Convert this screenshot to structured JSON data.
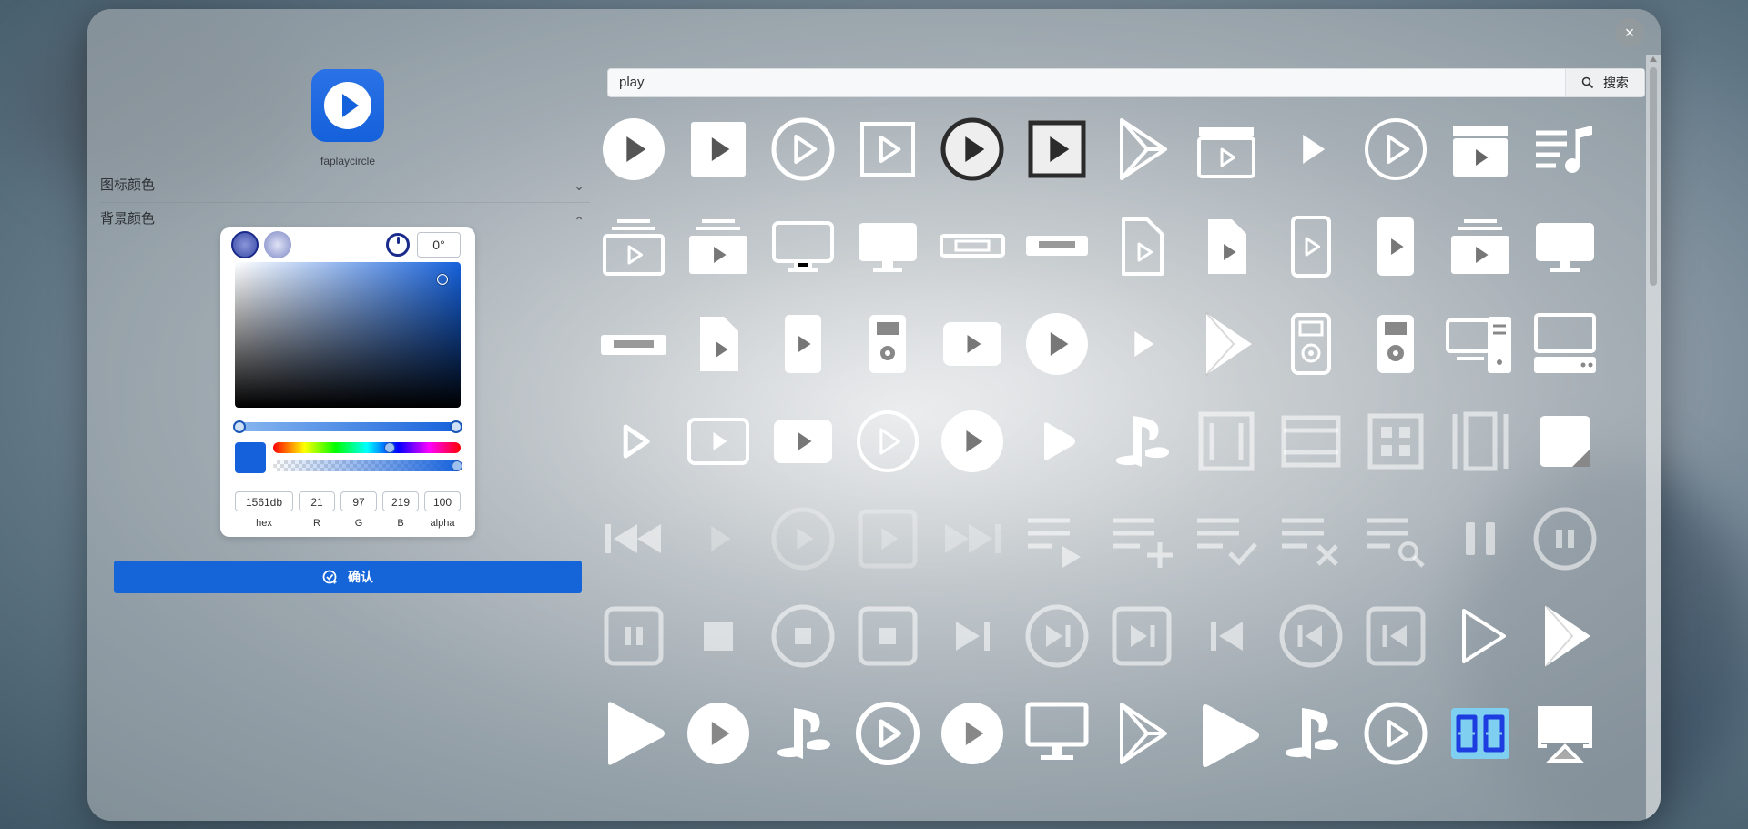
{
  "dialog": {
    "close_label": "×"
  },
  "preview": {
    "icon_name": "faplaycircle",
    "label": "faplaycircle"
  },
  "sections": {
    "icon_color": "图标颜色",
    "bg_color": "背景颜色"
  },
  "picker": {
    "angle": "0°",
    "hex": "1561db",
    "r": "21",
    "g": "97",
    "b": "219",
    "alpha": "100",
    "labels": {
      "hex": "hex",
      "r": "R",
      "g": "G",
      "b": "B",
      "alpha": "alpha"
    },
    "color": "#1561db"
  },
  "confirm_label": "确认",
  "search": {
    "value": "play",
    "button_label": "搜索"
  },
  "icons": [
    [
      "play-circle-filled",
      "play-square-filled",
      "play-circle-outline",
      "play-square-outline",
      "play-circle-dark",
      "play-square-dark",
      "google-play-outline",
      "clapperboard-play",
      "play-triangle",
      "play-circle-thin",
      "clapperboard-filled",
      "playlist-music"
    ],
    [
      "subscriptions-outline",
      "subscriptions-filled",
      "monitor-outline",
      "monitor-filled",
      "vhs-outline",
      "vhs-filled",
      "file-play-outline",
      "file-play-filled",
      "phone-play-outline",
      "phone-play-filled",
      "subscriptions-filled-alt",
      "monitor-filled-alt"
    ],
    [
      "vhs-filled-alt",
      "file-play-filled-alt",
      "phone-play-filled-alt",
      "ipod-filled",
      "video-play-filled",
      "play-circle-solid",
      "play-triangle-small",
      "google-play-filled",
      "ipod-outline",
      "ipod-solid",
      "devices-outline",
      "desktop-tower"
    ],
    [
      "play-outline-triangle",
      "video-play-outline",
      "video-play-solid",
      "play-circle-ring",
      "play-circle-solid-alt",
      "play-triangle-rounded",
      "playstation",
      "view-carousel",
      "view-agenda",
      "view-module",
      "view-array",
      "note-filled"
    ],
    [
      "skip-back",
      "play-faint",
      "play-circle-faint",
      "play-square-faint",
      "skip-forward",
      "playlist-play",
      "playlist-add",
      "playlist-check",
      "playlist-remove",
      "playlist-search",
      "pause",
      "pause-circle"
    ],
    [
      "pause-square",
      "stop",
      "stop-circle",
      "stop-square",
      "skip-next",
      "skip-next-circle",
      "skip-next-square",
      "skip-previous",
      "skip-previous-circle",
      "skip-previous-square",
      "play-outline-large",
      "google-play-solid"
    ],
    [
      "play-solid-large",
      "play-circle-bold",
      "playstation-alt",
      "play-circle-ring-bold",
      "play-circle-solid-bold",
      "monitor-stand",
      "google-play-outline-alt",
      "play-solid-xl",
      "playstation-small",
      "play-circle-ring-alt",
      "digital-counter",
      "airplay"
    ]
  ],
  "colors": {
    "accent": "#1561db",
    "counter_bg": "#7ecff0",
    "counter_fg": "#1e3de0"
  }
}
